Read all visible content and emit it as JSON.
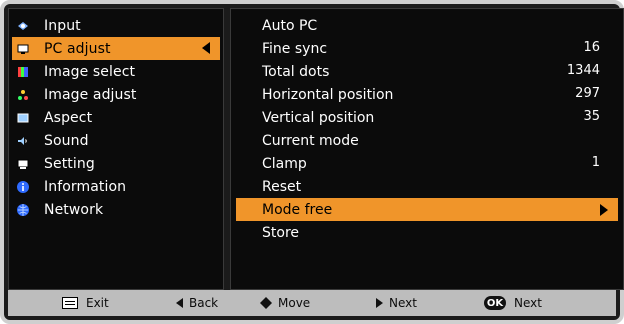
{
  "left_menu": {
    "items": [
      {
        "label": "Input",
        "icon": "input-icon"
      },
      {
        "label": "PC adjust",
        "icon": "pc-adjust-icon"
      },
      {
        "label": "Image select",
        "icon": "image-select-icon"
      },
      {
        "label": "Image adjust",
        "icon": "image-adjust-icon"
      },
      {
        "label": "Aspect",
        "icon": "aspect-icon"
      },
      {
        "label": "Sound",
        "icon": "sound-icon"
      },
      {
        "label": "Setting",
        "icon": "setting-icon"
      },
      {
        "label": "Information",
        "icon": "information-icon"
      },
      {
        "label": "Network",
        "icon": "network-icon"
      }
    ]
  },
  "pc_adjust": {
    "items": [
      {
        "label": "Auto PC",
        "value": ""
      },
      {
        "label": "Fine sync",
        "value": "16"
      },
      {
        "label": "Total dots",
        "value": "1344"
      },
      {
        "label": "Horizontal position",
        "value": "297"
      },
      {
        "label": "Vertical position",
        "value": "35"
      },
      {
        "label": "Current mode",
        "value": ""
      },
      {
        "label": "Clamp",
        "value": "1"
      },
      {
        "label": "Reset",
        "value": ""
      },
      {
        "label": "Mode free",
        "value": ""
      },
      {
        "label": "Store",
        "value": ""
      }
    ]
  },
  "bottom_bar": {
    "exit": "Exit",
    "back": "Back",
    "move": "Move",
    "next": "Next",
    "ok": "OK",
    "ok_next": "Next"
  }
}
